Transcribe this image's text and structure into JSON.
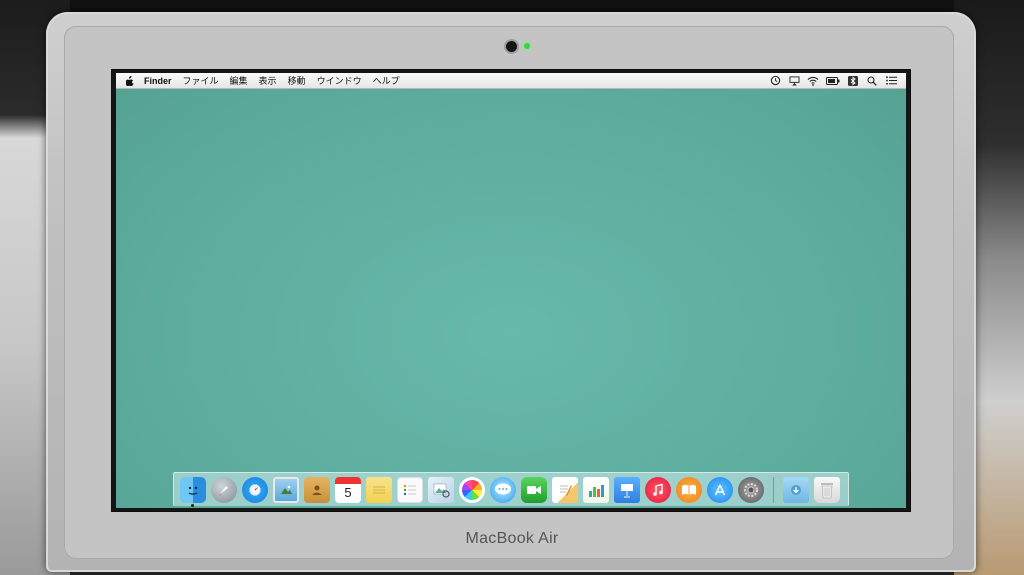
{
  "device": {
    "brand_label": "MacBook Air"
  },
  "menubar": {
    "apple_icon": "apple-logo-icon",
    "app_name": "Finder",
    "items": [
      "ファイル",
      "編集",
      "表示",
      "移動",
      "ウインドウ",
      "ヘルプ"
    ],
    "status_icons": [
      "time-machine-icon",
      "airplay-icon",
      "wifi-icon",
      "battery-icon",
      "bluetooth-icon",
      "spotlight-search-icon",
      "notification-center-icon"
    ]
  },
  "dock": {
    "apps": [
      {
        "name": "finder-icon",
        "running": true
      },
      {
        "name": "launchpad-icon"
      },
      {
        "name": "safari-icon"
      },
      {
        "name": "mail-icon"
      },
      {
        "name": "contacts-icon"
      },
      {
        "name": "calendar-icon",
        "day": "5"
      },
      {
        "name": "notes-icon"
      },
      {
        "name": "reminders-icon"
      },
      {
        "name": "preview-icon"
      },
      {
        "name": "photos-icon"
      },
      {
        "name": "messages-icon"
      },
      {
        "name": "facetime-icon"
      },
      {
        "name": "pages-icon"
      },
      {
        "name": "numbers-icon"
      },
      {
        "name": "keynote-icon"
      },
      {
        "name": "itunes-icon"
      },
      {
        "name": "ibooks-icon"
      },
      {
        "name": "app-store-icon"
      },
      {
        "name": "system-preferences-icon"
      }
    ],
    "stacks": [
      {
        "name": "downloads-folder-icon"
      },
      {
        "name": "trash-icon"
      }
    ]
  },
  "colors": {
    "desktop": "#5fb0a2",
    "camera_led": "#38d63c"
  }
}
